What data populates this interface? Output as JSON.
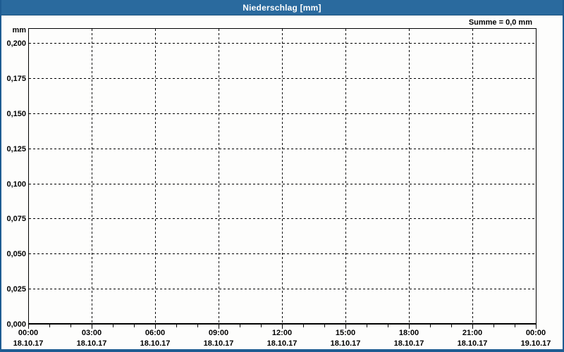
{
  "window": {
    "title": "Niederschlag [mm]"
  },
  "colors": {
    "titlebar": "#2a6a9e",
    "border": "#1e5c92",
    "background": "#fdfdfc",
    "plot_border": "#000000",
    "grid": "#000000",
    "text": "#000000",
    "title_text": "#ffffff"
  },
  "chart_data": {
    "type": "bar",
    "title": "Niederschlag [mm]",
    "ylabel": "mm",
    "xlabel": "",
    "annotation": "Summe = 0,0 mm",
    "grid": "dashed",
    "legend": "none",
    "y_axis": {
      "unit": "mm",
      "min": 0.0,
      "max": 0.2,
      "step": 0.025,
      "tick_labels": [
        "0,200",
        "0,175",
        "0,150",
        "0,125",
        "0,100",
        "0,075",
        "0,050",
        "0,025",
        "0,000"
      ],
      "tick_values": [
        0.2,
        0.175,
        0.15,
        0.125,
        0.1,
        0.075,
        0.05,
        0.025,
        0.0
      ]
    },
    "x_axis": {
      "start": "18.10.17 00:00",
      "end": "19.10.17 00:00",
      "major_tick_interval_hours": 3,
      "minor_tick_interval_hours": 1,
      "major_ticks": [
        {
          "time": "00:00",
          "date": "18.10.17"
        },
        {
          "time": "03:00",
          "date": "18.10.17"
        },
        {
          "time": "06:00",
          "date": "18.10.17"
        },
        {
          "time": "09:00",
          "date": "18.10.17"
        },
        {
          "time": "12:00",
          "date": "18.10.17"
        },
        {
          "time": "15:00",
          "date": "18.10.17"
        },
        {
          "time": "18:00",
          "date": "18.10.17"
        },
        {
          "time": "21:00",
          "date": "18.10.17"
        },
        {
          "time": "00:00",
          "date": "19.10.17"
        }
      ]
    },
    "series": [
      {
        "name": "Niederschlag",
        "values": [],
        "sum": 0.0
      }
    ]
  }
}
